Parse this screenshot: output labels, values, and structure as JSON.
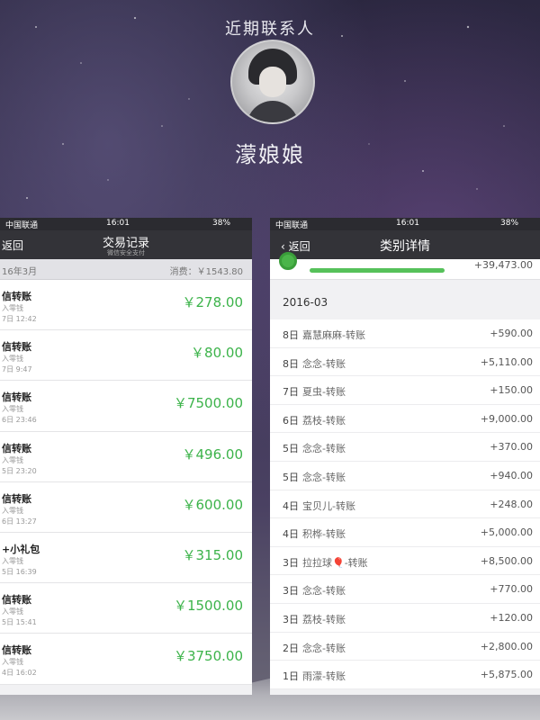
{
  "header": {
    "title": "近期联系人",
    "contact_name": "濛娘娘"
  },
  "left_screen": {
    "status": {
      "carrier": "中国联通",
      "time": "16:01",
      "battery": "38%"
    },
    "nav": {
      "back_label": "返回",
      "title": "交易记录",
      "subtitle": "微信安全支付"
    },
    "month": {
      "label": "16年3月",
      "total": "消费：￥1543.80"
    },
    "transactions": [
      {
        "title": "信转账",
        "subtitle": "入零钱",
        "date": "7日 12:42",
        "amount": "￥278.00"
      },
      {
        "title": "信转账",
        "subtitle": "入零钱",
        "date": "7日 9:47",
        "amount": "￥80.00"
      },
      {
        "title": "信转账",
        "subtitle": "入零钱",
        "date": "6日 23:46",
        "amount": "￥7500.00"
      },
      {
        "title": "信转账",
        "subtitle": "入零钱",
        "date": "5日 23:20",
        "amount": "￥496.00"
      },
      {
        "title": "信转账",
        "subtitle": "入零钱",
        "date": "6日 13:27",
        "amount": "￥600.00"
      },
      {
        "title": "+小礼包",
        "subtitle": "入零钱",
        "date": "5日 16:39",
        "amount": "￥315.00"
      },
      {
        "title": "信转账",
        "subtitle": "入零钱",
        "date": "5日 15:41",
        "amount": "￥1500.00"
      },
      {
        "title": "信转账",
        "subtitle": "入零钱",
        "date": "4日 16:02",
        "amount": "￥3750.00"
      }
    ]
  },
  "right_screen": {
    "status": {
      "carrier": "中国联通",
      "time": "16:01",
      "battery": "38%"
    },
    "nav": {
      "back_label": "返回",
      "title": "类别详情"
    },
    "category_total": "+39,473.00",
    "section": "2016-03",
    "rows": [
      {
        "day": "8日",
        "who": "嘉慧麻麻-转账",
        "amount": "+590.00"
      },
      {
        "day": "8日",
        "who": "念念-转账",
        "amount": "+5,110.00"
      },
      {
        "day": "7日",
        "who": "夏虫-转账",
        "amount": "+150.00"
      },
      {
        "day": "6日",
        "who": "荔枝-转账",
        "amount": "+9,000.00"
      },
      {
        "day": "5日",
        "who": "念念-转账",
        "amount": "+370.00"
      },
      {
        "day": "5日",
        "who": "念念-转账",
        "amount": "+940.00"
      },
      {
        "day": "4日",
        "who": "宝贝儿-转账",
        "amount": "+248.00"
      },
      {
        "day": "4日",
        "who": "积桦-转账",
        "amount": "+5,000.00"
      },
      {
        "day": "3日",
        "who": "拉拉球🎈-转账",
        "amount": "+8,500.00"
      },
      {
        "day": "3日",
        "who": "念念-转账",
        "amount": "+770.00"
      },
      {
        "day": "3日",
        "who": "荔枝-转账",
        "amount": "+120.00"
      },
      {
        "day": "2日",
        "who": "念念-转账",
        "amount": "+2,800.00"
      },
      {
        "day": "1日",
        "who": "雨濛-转账",
        "amount": "+5,875.00"
      }
    ]
  },
  "colors": {
    "amount_green": "#3cb34a",
    "nav_dark": "#333338",
    "progress_green": "#56c15a"
  }
}
